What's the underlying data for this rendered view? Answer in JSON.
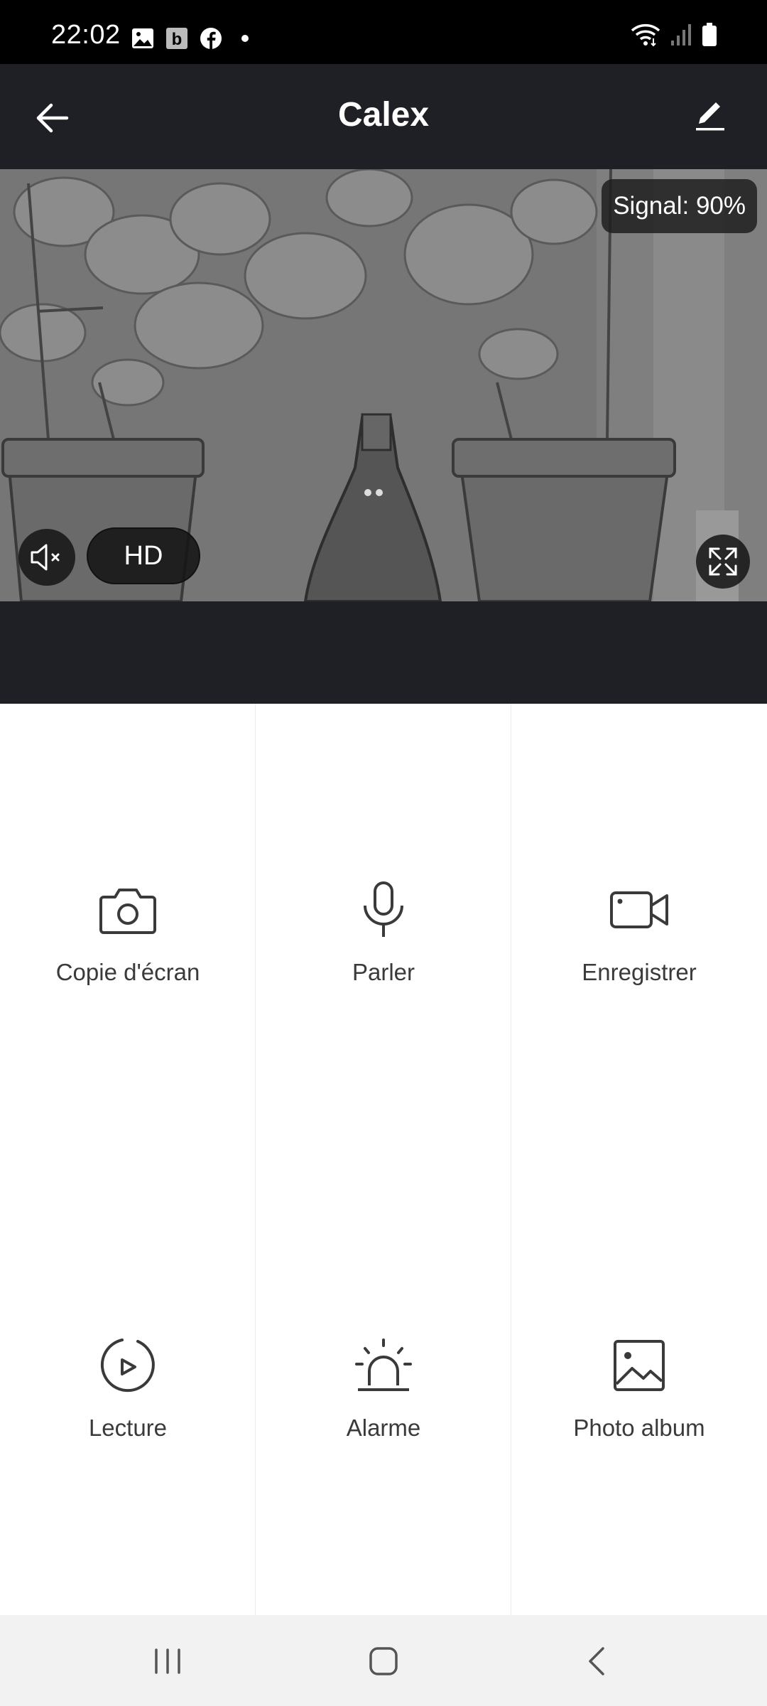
{
  "status_bar": {
    "time": "22:02",
    "notification_icons": [
      "image-icon",
      "b-app-icon",
      "facebook-icon",
      "dot-icon"
    ],
    "system_icons": [
      "wifi-icon",
      "cell-signal-icon",
      "battery-icon"
    ]
  },
  "header": {
    "title": "Calex",
    "back_icon": "back-arrow-icon",
    "edit_icon": "pencil-icon"
  },
  "video": {
    "signal_label": "Signal: 90%",
    "quality_label": "HD",
    "mute_icon": "speaker-muted-icon",
    "fullscreen_icon": "fullscreen-icon"
  },
  "actions": [
    {
      "label": "Copie d'écran",
      "icon": "camera-icon"
    },
    {
      "label": "Parler",
      "icon": "microphone-icon"
    },
    {
      "label": "Enregistrer",
      "icon": "video-camera-icon"
    },
    {
      "label": "Lecture",
      "icon": "playback-icon"
    },
    {
      "label": "Alarme",
      "icon": "alarm-siren-icon"
    },
    {
      "label": "Photo album",
      "icon": "photo-album-icon"
    }
  ],
  "navbar": {
    "icons": [
      "recent-apps-icon",
      "home-icon",
      "back-icon"
    ]
  },
  "colors": {
    "header_bg": "#1f1f26",
    "status_bg": "#000000",
    "icon_color": "#3a3a3a",
    "nav_bg": "#f2f2f2"
  }
}
